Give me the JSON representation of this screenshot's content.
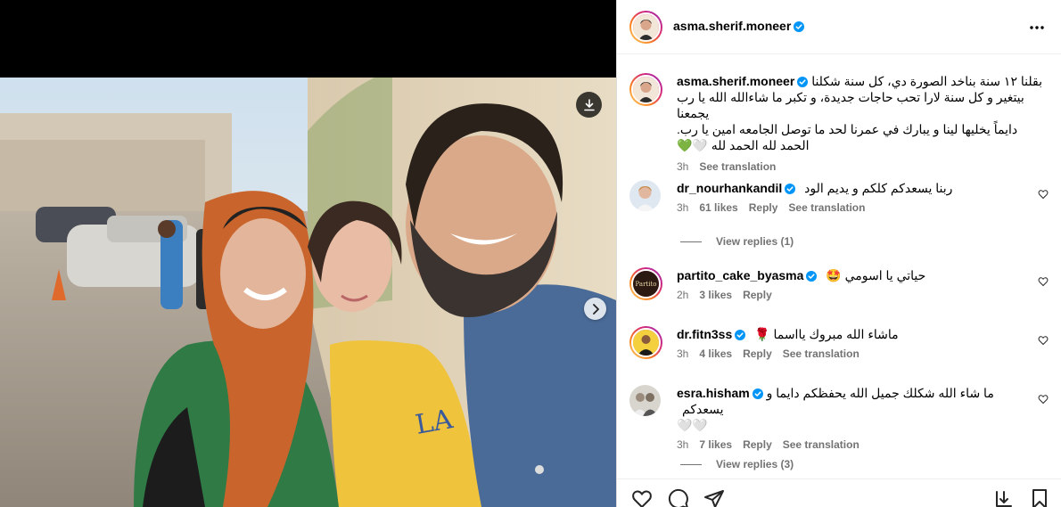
{
  "post": {
    "author": "asma.sherif.moneer",
    "caption": {
      "line1": "بقلنا ١٢ سنة بناخد الصورة دي، كل سنة شكلنا",
      "line2": "بيتغير و كل سنة لارا تحب حاجات جديدة، و تكبر ما شاءالله الله يا رب يجمعنا",
      "line3": "دايماً يخليها لينا و يبارك في عمرنا لحد ما توصل الجامعه امين يا رب.",
      "line4": "الحمد لله الحمد لله 🤍💚",
      "time": "3h",
      "see_translation": "See translation"
    }
  },
  "comments": [
    {
      "user": "dr_nourhankandil",
      "text": "ربنا يسعدكم كلكم و يديم الود",
      "time": "3h",
      "likes": "61 likes",
      "reply": "Reply",
      "translate": "See translation",
      "view_replies": "View replies (1)"
    },
    {
      "user": "partito_cake_byasma",
      "text": "حياتي يا اسومي 🤩",
      "time": "2h",
      "likes": "3 likes",
      "reply": "Reply"
    },
    {
      "user": "dr.fitn3ss",
      "text": "ماشاء الله مبروك يااسما 🌹",
      "time": "3h",
      "likes": "4 likes",
      "reply": "Reply",
      "translate": "See translation"
    },
    {
      "user": "esra.hisham",
      "text": "ما شاء الله شكلك جميل الله يحفظكم دايما و يسعدكم",
      "text2": "🤍🤍",
      "time": "3h",
      "likes": "7 likes",
      "reply": "Reply",
      "translate": "See translation",
      "view_replies": "View replies (3)"
    }
  ],
  "icons": {
    "download": "download-icon",
    "next": "chevron-right-icon",
    "more": "more-horizontal-icon",
    "like": "heart-icon",
    "comment": "comment-icon",
    "share": "share-icon",
    "save": "bookmark-icon",
    "verified": "verified-badge-icon"
  },
  "colors": {
    "verified": "#0095f6",
    "meta": "#737373",
    "border": "#dbdbdb"
  }
}
